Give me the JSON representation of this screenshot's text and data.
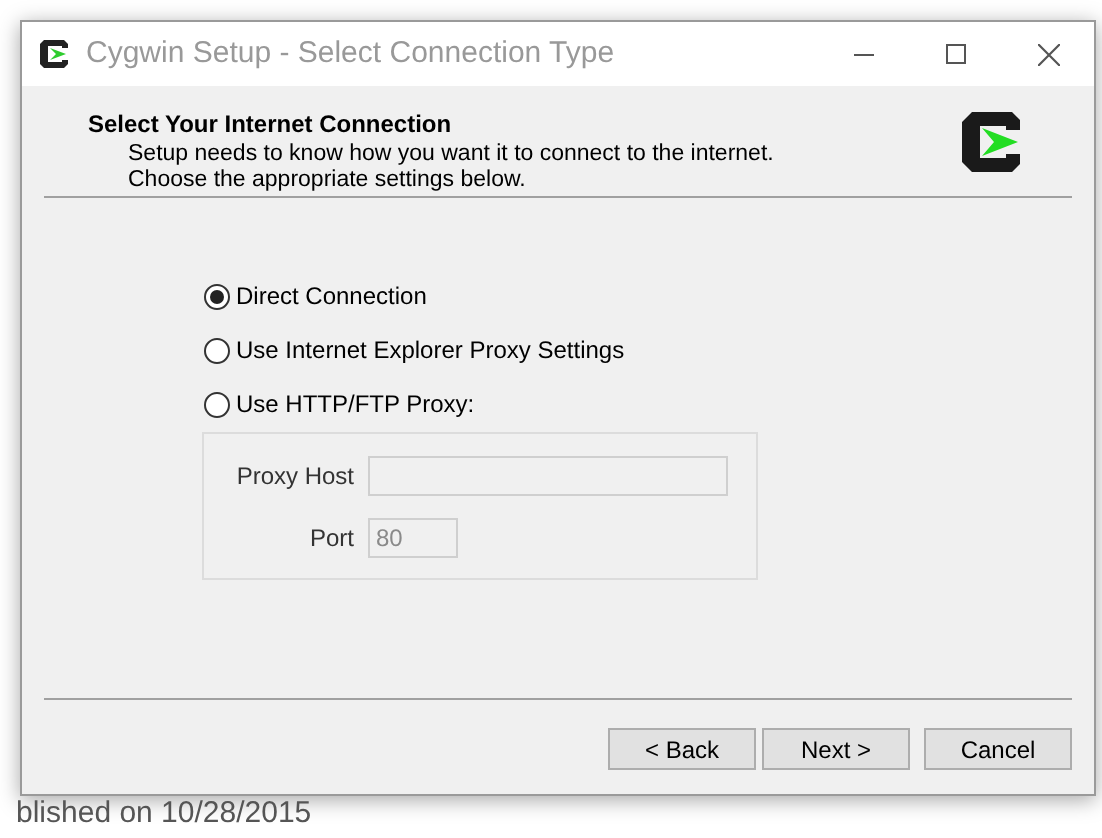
{
  "window": {
    "title": "Cygwin Setup - Select Connection Type"
  },
  "header": {
    "title": "Select Your Internet Connection",
    "description": "Setup needs to know how you want it to connect to the internet.  Choose the appropriate settings below."
  },
  "options": [
    {
      "label": "Direct Connection",
      "selected": true
    },
    {
      "label": "Use Internet Explorer Proxy Settings",
      "selected": false
    },
    {
      "label": "Use HTTP/FTP Proxy:",
      "selected": false
    }
  ],
  "proxy": {
    "disabled": true,
    "host": {
      "label": "Proxy Host"
    },
    "port": {
      "label": "Port",
      "value": "80"
    }
  },
  "buttons": [
    {
      "label": "< Back"
    },
    {
      "label": "Next >"
    },
    {
      "label": "Cancel"
    }
  ],
  "background_page": {
    "text": "blished on 10/28/2015"
  }
}
